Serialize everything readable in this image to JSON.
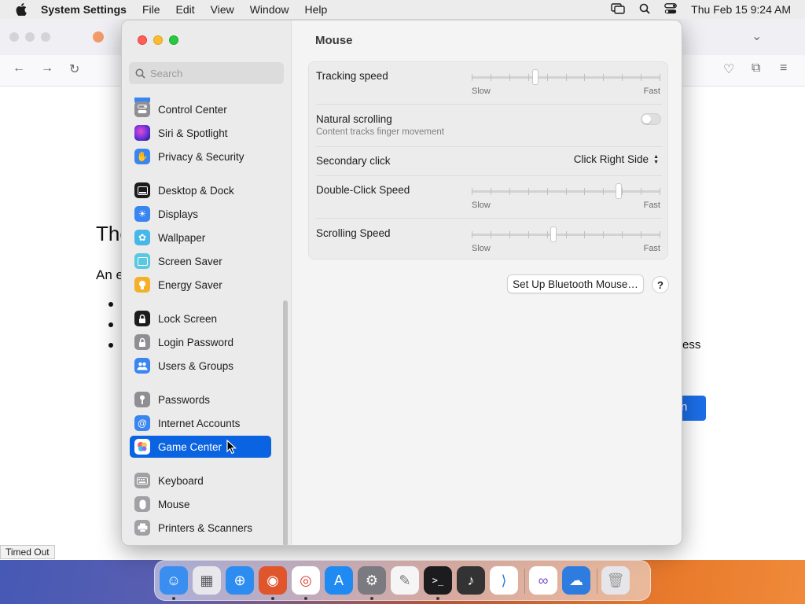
{
  "menubar": {
    "app_name": "System Settings",
    "menus": [
      "File",
      "Edit",
      "View",
      "Window",
      "Help"
    ],
    "clock": "Thu Feb 15  9:24 AM"
  },
  "browser": {
    "heading_fragment": "The",
    "text_fragment": "An e",
    "right_fragment": "ess",
    "button_fragment": "n",
    "status": "Timed Out"
  },
  "sidebar": {
    "search_placeholder": "Search",
    "items": [
      {
        "label": "Control Center",
        "icon": "control-center-icon",
        "color": "#8e8e93"
      },
      {
        "label": "Siri & Spotlight",
        "icon": "siri-icon",
        "color": "#7b3fd6"
      },
      {
        "label": "Privacy & Security",
        "icon": "hand-icon",
        "color": "#3a86f0"
      },
      {
        "label": "Desktop & Dock",
        "icon": "dock-icon",
        "color": "#1c1c1e"
      },
      {
        "label": "Displays",
        "icon": "sun-icon",
        "color": "#3a86f0"
      },
      {
        "label": "Wallpaper",
        "icon": "flower-icon",
        "color": "#45b7e8"
      },
      {
        "label": "Screen Saver",
        "icon": "screen-saver-icon",
        "color": "#5ac8e0"
      },
      {
        "label": "Energy Saver",
        "icon": "bulb-icon",
        "color": "#f5b02a"
      },
      {
        "label": "Lock Screen",
        "icon": "lock-icon",
        "color": "#1c1c1e"
      },
      {
        "label": "Login Password",
        "icon": "lock-icon",
        "color": "#8e8e93"
      },
      {
        "label": "Users & Groups",
        "icon": "users-icon",
        "color": "#3a86f0"
      },
      {
        "label": "Passwords",
        "icon": "key-icon",
        "color": "#8e8e93"
      },
      {
        "label": "Internet Accounts",
        "icon": "at-icon",
        "color": "#3a86f0"
      },
      {
        "label": "Game Center",
        "icon": "game-center-icon",
        "color": "#ffffff"
      },
      {
        "label": "Keyboard",
        "icon": "keyboard-icon",
        "color": "#a0a0a5"
      },
      {
        "label": "Mouse",
        "icon": "mouse-icon",
        "color": "#a0a0a5"
      },
      {
        "label": "Printers & Scanners",
        "icon": "printer-icon",
        "color": "#a0a0a5"
      }
    ],
    "selected": "Game Center"
  },
  "main": {
    "title": "Mouse",
    "tracking_speed": {
      "label": "Tracking speed",
      "slow": "Slow",
      "fast": "Fast",
      "value": 0.33
    },
    "natural_scrolling": {
      "label": "Natural scrolling",
      "sub": "Content tracks finger movement",
      "on": false
    },
    "secondary_click": {
      "label": "Secondary click",
      "value": "Click Right Side"
    },
    "double_click_speed": {
      "label": "Double-Click Speed",
      "slow": "Slow",
      "fast": "Fast",
      "value": 0.79
    },
    "scrolling_speed": {
      "label": "Scrolling Speed",
      "slow": "Slow",
      "fast": "Fast",
      "value": 0.43
    },
    "bluetooth_button": "Set Up Bluetooth Mouse…",
    "help_button": "?"
  },
  "dock": {
    "apps": [
      {
        "name": "finder-icon",
        "color": "#3a8ef0",
        "running": true
      },
      {
        "name": "launchpad-icon",
        "color": "#e8e8ec",
        "running": false
      },
      {
        "name": "safari-icon",
        "color": "#2d8cf0",
        "running": false
      },
      {
        "name": "firefox-icon",
        "color": "#e0552c",
        "running": true
      },
      {
        "name": "chrome-icon",
        "color": "#ffffff",
        "running": true
      },
      {
        "name": "app-store-icon",
        "color": "#1f8bf2",
        "running": false
      },
      {
        "name": "system-settings-icon",
        "color": "#7a7a80",
        "running": true
      },
      {
        "name": "textedit-icon",
        "color": "#f5f5f5",
        "running": false
      },
      {
        "name": "terminal-icon",
        "color": "#1c1c1e",
        "running": true
      },
      {
        "name": "garageband-icon",
        "color": "#333333",
        "running": false
      },
      {
        "name": "vscode-icon",
        "color": "#ffffff",
        "running": false
      },
      {
        "name": "visual-studio-icon",
        "color": "#ffffff",
        "running": false
      },
      {
        "name": "weather-icon",
        "color": "#2f7ce0",
        "running": false
      },
      {
        "name": "trash-icon",
        "color": "#e6e6ea",
        "running": false
      }
    ]
  }
}
